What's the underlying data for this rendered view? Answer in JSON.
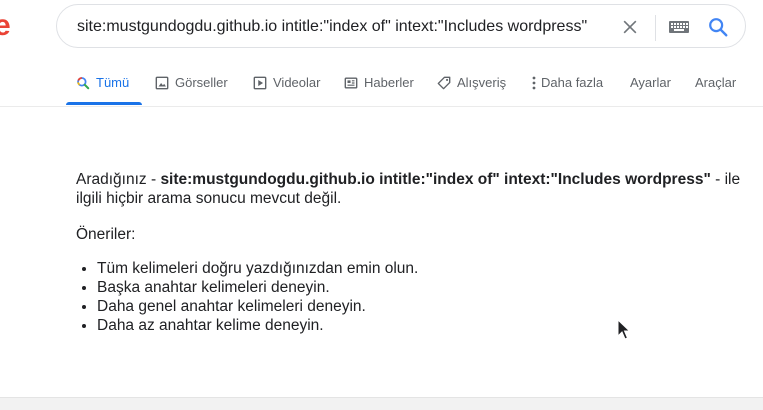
{
  "logo": {
    "fragment": "e"
  },
  "search": {
    "query": "site:mustgundogdu.github.io intitle:\"index of\" intext:\"Includes wordpress\""
  },
  "icons": {
    "clear": "close-icon",
    "keyboard": "keyboard-icon",
    "search": "search-icon"
  },
  "tabs": [
    {
      "label": "Tümü",
      "icon": "search-icon",
      "active": true
    },
    {
      "label": "Görseller",
      "icon": "image-icon"
    },
    {
      "label": "Videolar",
      "icon": "play-icon"
    },
    {
      "label": "Haberler",
      "icon": "news-icon"
    },
    {
      "label": "Alışveriş",
      "icon": "tag-icon"
    },
    {
      "label": "Daha fazla",
      "icon": "more-vert-icon"
    },
    {
      "label": "Ayarlar"
    },
    {
      "label": "Araçlar"
    }
  ],
  "no_results": {
    "prefix": "Aradığınız - ",
    "query": "site:mustgundogdu.github.io intitle:\"index of\" intext:\"Includes wordpress\"",
    "suffix": " - ile ilgili hiçbir arama sonucu mevcut değil."
  },
  "suggestions": {
    "title": "Öneriler:",
    "items": [
      "Tüm kelimeleri doğru yazdığınızdan emin olun.",
      "Başka anahtar kelimeleri deneyin.",
      "Daha genel anahtar kelimeleri deneyin.",
      "Daha az anahtar kelime deneyin."
    ]
  },
  "colors": {
    "accent": "#1a73e8",
    "text": "#202124",
    "muted": "#5f6368",
    "logo_orange": "#ea4335"
  }
}
